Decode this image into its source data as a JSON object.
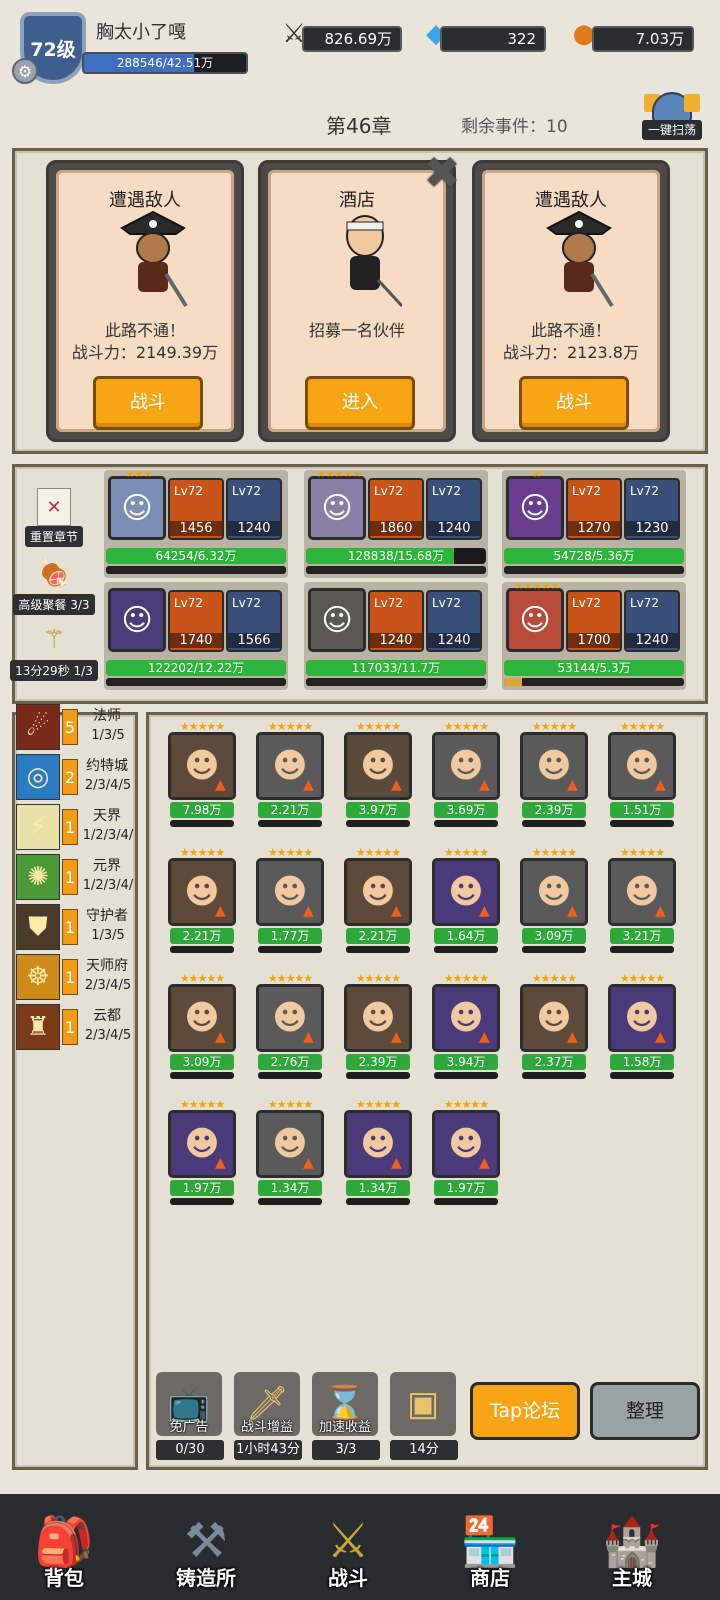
{
  "player": {
    "level": "72级",
    "name": "胸太小了嘎",
    "xp": "288546/42.51万",
    "xp_progress": 0.68
  },
  "resources": {
    "power": "826.69万",
    "gems": "322",
    "gold": "7.03万"
  },
  "stage": {
    "chapter": "第46章",
    "remaining": "剩余事件：10",
    "sweep_label": "一键扫荡"
  },
  "events": [
    {
      "title": "遭遇敌人",
      "desc1": "此路不通！",
      "desc2": "战斗力：2149.39万",
      "button": "战斗"
    },
    {
      "title": "酒店",
      "desc1": "招募一名伙伴",
      "desc2": "",
      "button": "进入"
    },
    {
      "title": "遭遇敌人",
      "desc1": "此路不通！",
      "desc2": "战斗力：2123.8万",
      "button": "战斗"
    }
  ],
  "side_actions": {
    "reset": "重置章节",
    "feast": "高级聚餐 3/3",
    "timer": "13分29秒 1/3"
  },
  "party": [
    {
      "stars": "★★★",
      "w_lv": "Lv72",
      "w_val": "1456",
      "a_lv": "Lv72",
      "a_val": "1240",
      "hp": "64254/6.32万",
      "hp_pct": 1.0,
      "sub_pct": 0.0,
      "color": "#7b8fb5",
      "icon": "elf-hero"
    },
    {
      "stars": "★★★★★",
      "w_lv": "Lv72",
      "w_val": "1860",
      "a_lv": "Lv72",
      "a_val": "1240",
      "hp": "128838/15.68万",
      "hp_pct": 0.82,
      "sub_pct": 0.0,
      "color": "#8a7da6",
      "icon": "white-hair-hero"
    },
    {
      "stars": "★",
      "w_lv": "Lv72",
      "w_val": "1270",
      "a_lv": "Lv72",
      "a_val": "1230",
      "hp": "54728/5.36万",
      "hp_pct": 1.0,
      "sub_pct": 0.0,
      "color": "#6a3d8f",
      "icon": "purple-hair-hero"
    },
    {
      "stars": "",
      "w_lv": "Lv72",
      "w_val": "1740",
      "a_lv": "Lv72",
      "a_val": "1566",
      "hp": "122202/12.22万",
      "hp_pct": 1.0,
      "sub_pct": 0.0,
      "color": "#4a3d7a",
      "icon": "demon-hero"
    },
    {
      "stars": "",
      "w_lv": "Lv72",
      "w_val": "1240",
      "a_lv": "Lv72",
      "a_val": "1240",
      "hp": "117033/11.7万",
      "hp_pct": 1.0,
      "sub_pct": 0.0,
      "color": "#5a5a52",
      "icon": "knight-hero"
    },
    {
      "stars": "★★★★★",
      "w_lv": "Lv72",
      "w_val": "1700",
      "a_lv": "Lv72",
      "a_val": "1240",
      "hp": "53144/5.3万",
      "hp_pct": 1.0,
      "sub_pct": 0.1,
      "color": "#b84a3a",
      "icon": "fire-hero"
    }
  ],
  "factions": [
    {
      "name": "法师",
      "count": "5",
      "steps": "1/3/5",
      "icon": "fire-rain-icon",
      "color": "#7a2a1a"
    },
    {
      "name": "约特城",
      "count": "2",
      "steps": "2/3/4/5",
      "icon": "vortex-icon",
      "color": "#2b7bc4"
    },
    {
      "name": "天界",
      "count": "1",
      "steps": "1/2/3/4/",
      "icon": "lightning-icon",
      "color": "#e8e2a8"
    },
    {
      "name": "元界",
      "count": "1",
      "steps": "1/2/3/4/",
      "icon": "nature-icon",
      "color": "#4a9a3a"
    },
    {
      "name": "守护者",
      "count": "1",
      "steps": "1/3/5",
      "icon": "shield-icon",
      "color": "#4a3a28"
    },
    {
      "name": "天师府",
      "count": "1",
      "steps": "2/3/4/5",
      "icon": "meditation-icon",
      "color": "#d08a1a"
    },
    {
      "name": "云都",
      "count": "1",
      "steps": "2/3/4/5",
      "icon": "helmet-icon",
      "color": "#7a3a18"
    }
  ],
  "roster": [
    {
      "power": "7.98万",
      "bg": "#5e4a3a",
      "icon": "horned-hero"
    },
    {
      "power": "2.21万",
      "bg": "#5a5a5a",
      "icon": "white-elf-hero"
    },
    {
      "power": "3.97万",
      "bg": "#5a4a3a",
      "icon": "masked-hero"
    },
    {
      "power": "3.69万",
      "bg": "#5a5a5a",
      "icon": "robot-hero"
    },
    {
      "power": "2.39万",
      "bg": "#5a5a5a",
      "icon": "blue-hair-hero"
    },
    {
      "power": "1.51万",
      "bg": "#5a5a5a",
      "icon": "red-hair-hero"
    },
    {
      "power": "2.21万",
      "bg": "#5e4a3a",
      "icon": "cowboy-hero"
    },
    {
      "power": "1.77万",
      "bg": "#5a5a5a",
      "icon": "goggles-hero"
    },
    {
      "power": "2.21万",
      "bg": "#5e4a3a",
      "icon": "hunter-hero"
    },
    {
      "power": "1.64万",
      "bg": "#4a3a7a",
      "icon": "visor-hero"
    },
    {
      "power": "3.09万",
      "bg": "#5a5a5a",
      "icon": "valkyrie-hero"
    },
    {
      "power": "3.21万",
      "bg": "#5a5a5a",
      "icon": "brown-hair-hero"
    },
    {
      "power": "3.09万",
      "bg": "#5e4a3a",
      "icon": "cap-hero"
    },
    {
      "power": "2.76万",
      "bg": "#5a5a5a",
      "icon": "hooded-hero"
    },
    {
      "power": "2.39万",
      "bg": "#5e4a3a",
      "icon": "helmet-hero"
    },
    {
      "power": "3.94万",
      "bg": "#4a3a7a",
      "icon": "monk-hero"
    },
    {
      "power": "2.37万",
      "bg": "#5e4a3a",
      "icon": "feather-hat-hero"
    },
    {
      "power": "1.58万",
      "bg": "#4a3a7a",
      "icon": "green-hair-hero"
    },
    {
      "power": "1.97万",
      "bg": "#4a3a7a",
      "icon": "blue-hood-hero"
    },
    {
      "power": "1.34万",
      "bg": "#5a5a5a",
      "icon": "mohawk-hero"
    },
    {
      "power": "1.34万",
      "bg": "#4a3a7a",
      "icon": "punk-hero"
    },
    {
      "power": "1.97万",
      "bg": "#4a3a7a",
      "icon": "bandana-hero"
    }
  ],
  "tools": [
    {
      "name": "免广告",
      "value": "0/30",
      "icon": "tv-icon"
    },
    {
      "name": "战斗增益",
      "value": "1小时43分",
      "icon": "sword-tv-icon"
    },
    {
      "name": "加速收益",
      "value": "3/3",
      "icon": "hourglass-icon"
    },
    {
      "name": "",
      "value": "14分",
      "icon": "chest-icon"
    }
  ],
  "buttons": {
    "forum": "Tap论坛",
    "organize": "整理"
  },
  "nav": [
    {
      "label": "背包",
      "icon": "backpack-icon"
    },
    {
      "label": "铸造所",
      "icon": "anvil-icon"
    },
    {
      "label": "战斗",
      "icon": "crossed-swords-icon"
    },
    {
      "label": "商店",
      "icon": "shop-icon"
    },
    {
      "label": "主城",
      "icon": "castle-icon"
    }
  ],
  "colors": {
    "accent_orange": "#f7a514",
    "hp_green": "#2db43a",
    "panel_bg": "#e4e0d3"
  }
}
